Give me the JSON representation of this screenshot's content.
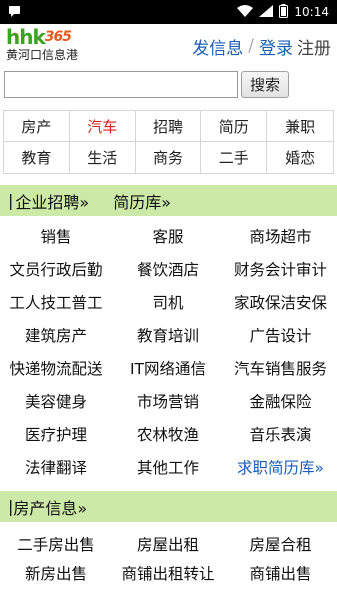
{
  "status": {
    "time": "10:14"
  },
  "header": {
    "logo_main": "hhk",
    "logo_num": "365",
    "logo_sub": "黄河口信息港",
    "post_label": "发信息",
    "login_label": "登录",
    "register_label": "注册"
  },
  "search": {
    "placeholder": "",
    "button_label": "搜索"
  },
  "categories": [
    "房产",
    "汽车",
    "招聘",
    "简历",
    "兼职",
    "教育",
    "生活",
    "商务",
    "二手",
    "婚恋"
  ],
  "job_section": {
    "sep": "|",
    "title": "企业招聘»",
    "resume_link": "简历库»"
  },
  "jobs": [
    "销售",
    "客服",
    "商场超市",
    "文员行政后勤",
    "餐饮酒店",
    "财务会计审计",
    "工人技工普工",
    "司机",
    "家政保洁安保",
    "建筑房产",
    "教育培训",
    "广告设计",
    "快递物流配送",
    "IT网络通信",
    "汽车销售服务",
    "美容健身",
    "市场营销",
    "金融保险",
    "医疗护理",
    "农林牧渔",
    "音乐表演",
    "法律翻译",
    "其他工作",
    "求职简历库»"
  ],
  "house_section": {
    "sep": "|",
    "title": "房产信息»"
  },
  "house": [
    "二手房出售",
    "房屋出租",
    "房屋合租",
    "新房出售",
    "商铺出租转让",
    "商铺出售"
  ],
  "colors": {
    "accent_blue": "#1a5fb4",
    "section_green": "#cde9a8",
    "highlight_red": "#d4271b",
    "logo_green": "#3aa320"
  }
}
